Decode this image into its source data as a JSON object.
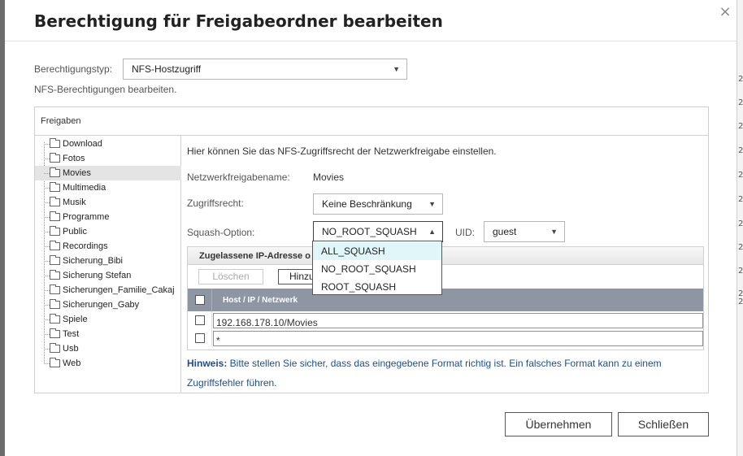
{
  "dialog": {
    "title": "Berechtigung für Freigabeordner bearbeiten",
    "close_glyph": "×",
    "permission_type_label": "Berechtigungstyp:",
    "permission_type_value": "NFS-Hostzugriff",
    "subtitle": "NFS-Berechtigungen bearbeiten."
  },
  "shares_panel": {
    "header": "Freigaben",
    "folders": [
      "Download",
      "Fotos",
      "Movies",
      "Multimedia",
      "Musik",
      "Programme",
      "Public",
      "Recordings",
      "Sicherung_Bibi",
      "Sicherung Stefan",
      "Sicherungen_Familie_Cakaj",
      "Sicherungen_Gaby",
      "Spiele",
      "Test",
      "Usb",
      "Web"
    ],
    "selected": "Movies"
  },
  "nfs": {
    "intro": "Hier können Sie das NFS-Zugriffsrecht der Netzwerkfreigabe einstellen.",
    "share_name_label": "Netzwerkfreigabename:",
    "share_name_value": "Movies",
    "access_label": "Zugriffsrecht:",
    "access_value": "Keine Beschränkung",
    "squash_label": "Squash-Option:",
    "squash_value": "NO_ROOT_SQUASH",
    "uid_label": "UID:",
    "uid_value": "guest",
    "squash_options": [
      "ALL_SQUASH",
      "NO_ROOT_SQUASH",
      "ROOT_SQUASH"
    ],
    "squash_highlighted": "ALL_SQUASH"
  },
  "ip_grid": {
    "title": "Zugelassene IP-Adresse o",
    "delete_label": "Löschen",
    "add_label": "Hinzu",
    "column_header": "Host / IP / Netzwerk",
    "rows": [
      "192.168.178.10/Movies",
      "*"
    ]
  },
  "hint": {
    "bold": "Hinweis:",
    "text": " Bitte stellen Sie sicher, dass das eingegebene Format richtig ist. Ein falsches Format kann zu einem Zugriffsfehler führen."
  },
  "buttons": {
    "apply": "Übernehmen",
    "close": "Schließen"
  },
  "background_marks": [
    "2",
    "2",
    "2",
    "2",
    "2",
    "2",
    "2",
    "2",
    "2",
    "2",
    "2"
  ]
}
